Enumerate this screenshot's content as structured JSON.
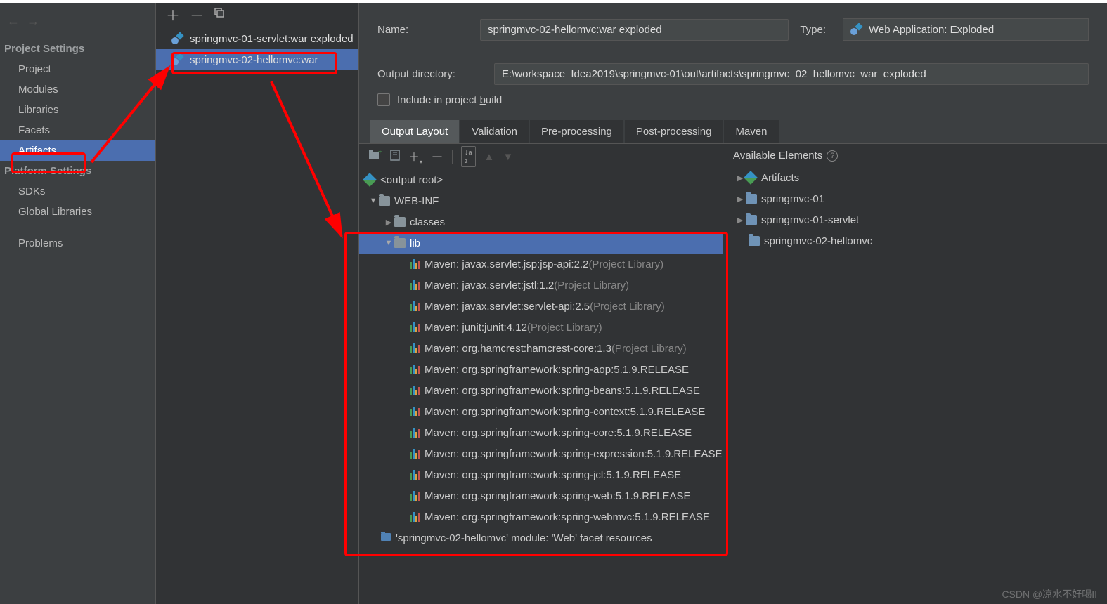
{
  "sidebar": {
    "projectSettingsHeader": "Project Settings",
    "items": [
      {
        "label": "Project"
      },
      {
        "label": "Modules"
      },
      {
        "label": "Libraries"
      },
      {
        "label": "Facets"
      },
      {
        "label": "Artifacts"
      }
    ],
    "platformSettingsHeader": "Platform Settings",
    "platformItems": [
      {
        "label": "SDKs"
      },
      {
        "label": "Global Libraries"
      }
    ],
    "problems": "Problems"
  },
  "midpanel": {
    "artifacts": [
      {
        "label": "springmvc-01-servlet:war exploded"
      },
      {
        "label": "springmvc-02-hellomvc:war"
      }
    ]
  },
  "form": {
    "nameLabel": "Name:",
    "name": "springmvc-02-hellomvc:war exploded",
    "typeLabel": "Type:",
    "typeValue": "Web Application: Exploded",
    "outputDirLabel": "Output directory:",
    "outputDir": "E:\\workspace_Idea2019\\springmvc-01\\out\\artifacts\\springmvc_02_hellomvc_war_exploded",
    "includeInBuild": "Include in project build"
  },
  "tabs": [
    {
      "label": "Output Layout",
      "active": true
    },
    {
      "label": "Validation"
    },
    {
      "label": "Pre-processing"
    },
    {
      "label": "Post-processing"
    },
    {
      "label": "Maven"
    }
  ],
  "tree": {
    "root": "<output root>",
    "webinf": "WEB-INF",
    "classes": "classes",
    "lib": "lib",
    "libs": [
      {
        "label": "Maven: javax.servlet.jsp:jsp-api:2.2",
        "hint": "(Project Library)"
      },
      {
        "label": "Maven: javax.servlet:jstl:1.2",
        "hint": "(Project Library)"
      },
      {
        "label": "Maven: javax.servlet:servlet-api:2.5",
        "hint": "(Project Library)"
      },
      {
        "label": "Maven: junit:junit:4.12",
        "hint": "(Project Library)"
      },
      {
        "label": "Maven: org.hamcrest:hamcrest-core:1.3",
        "hint": "(Project Library)"
      },
      {
        "label": "Maven: org.springframework:spring-aop:5.1.9.RELEASE",
        "hint": ""
      },
      {
        "label": "Maven: org.springframework:spring-beans:5.1.9.RELEASE",
        "hint": ""
      },
      {
        "label": "Maven: org.springframework:spring-context:5.1.9.RELEASE",
        "hint": ""
      },
      {
        "label": "Maven: org.springframework:spring-core:5.1.9.RELEASE",
        "hint": ""
      },
      {
        "label": "Maven: org.springframework:spring-expression:5.1.9.RELEASE",
        "hint": ""
      },
      {
        "label": "Maven: org.springframework:spring-jcl:5.1.9.RELEASE",
        "hint": ""
      },
      {
        "label": "Maven: org.springframework:spring-web:5.1.9.RELEASE",
        "hint": ""
      },
      {
        "label": "Maven: org.springframework:spring-webmvc:5.1.9.RELEASE",
        "hint": ""
      }
    ],
    "facet": "'springmvc-02-hellomvc' module: 'Web' facet resources"
  },
  "avail": {
    "header": "Available Elements",
    "artifacts": "Artifacts",
    "items": [
      {
        "label": "springmvc-01"
      },
      {
        "label": "springmvc-01-servlet"
      },
      {
        "label": "springmvc-02-hellomvc"
      }
    ]
  },
  "watermark": "CSDN @凉水不好喝II"
}
